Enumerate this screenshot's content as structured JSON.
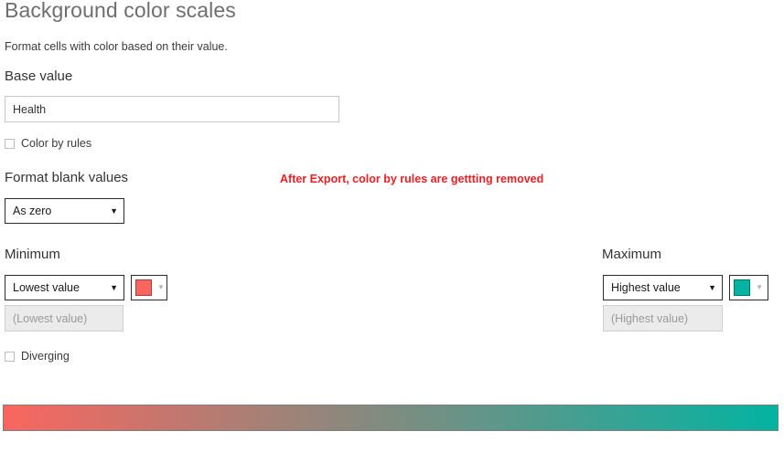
{
  "page": {
    "title": "Background color scales",
    "description": "Format cells with color based on their value."
  },
  "base_value": {
    "label": "Base value",
    "value": "Health",
    "placeholder": ""
  },
  "color_by_rules": {
    "label": "Color by rules",
    "checked": false
  },
  "format_blank_values": {
    "label": "Format blank values",
    "selected": "As zero",
    "caret": "▼"
  },
  "annotation": {
    "text": "After Export, color by rules are gettting removed",
    "color": "#ec2024"
  },
  "minimum": {
    "label": "Minimum",
    "selected": "Lowest value",
    "caret": "▼",
    "color": "#f9665f",
    "swatch_caret": "▼",
    "value": "",
    "placeholder": "(Lowest value)"
  },
  "maximum": {
    "label": "Maximum",
    "selected": "Highest value",
    "caret": "▼",
    "color": "#04b3a2",
    "swatch_caret": "▼",
    "value": "",
    "placeholder": "(Highest value)"
  },
  "diverging": {
    "label": "Diverging",
    "checked": false
  },
  "gradient_preview": {
    "from": "#f9665f",
    "to": "#04b3a2"
  }
}
